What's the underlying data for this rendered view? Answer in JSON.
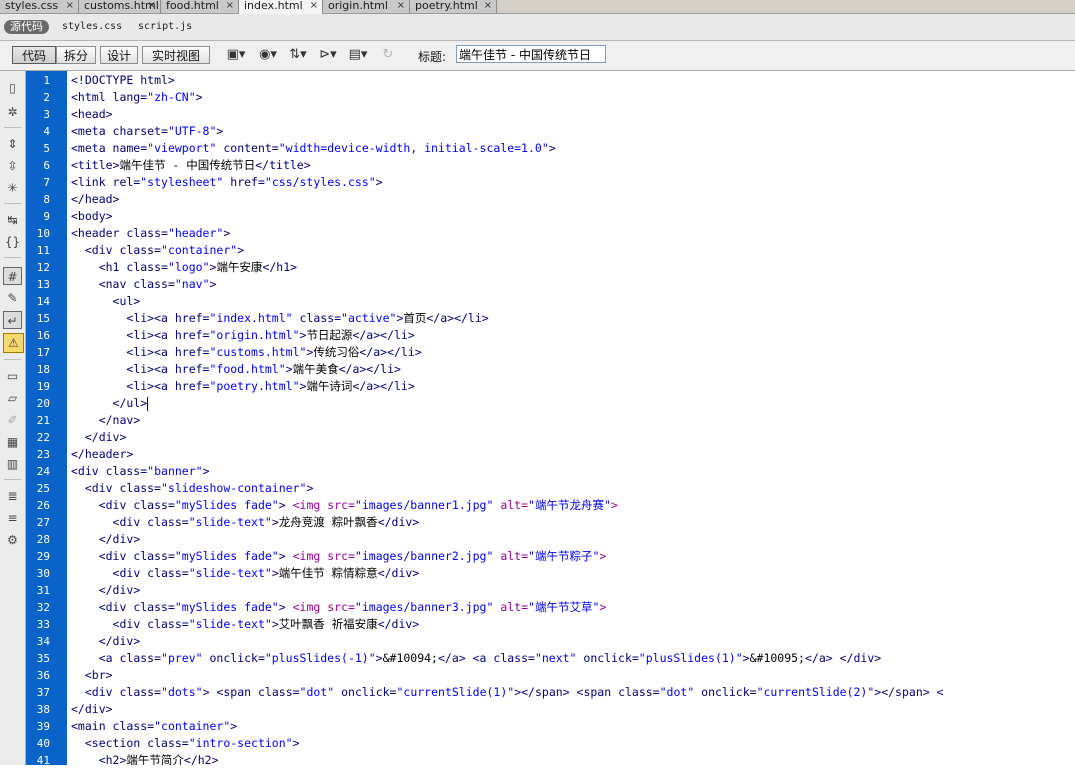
{
  "tabs": [
    {
      "label": "styles.css",
      "active": false
    },
    {
      "label": "customs.html",
      "active": false
    },
    {
      "label": "food.html",
      "active": false
    },
    {
      "label": "index.html",
      "active": true
    },
    {
      "label": "origin.html",
      "active": false
    },
    {
      "label": "poetry.html",
      "active": false
    }
  ],
  "tab_close_glyph": "×",
  "related": {
    "source_label": "源代码",
    "files": [
      "styles.css",
      "script.js"
    ]
  },
  "toolbar": {
    "view_buttons": [
      "代码",
      "拆分",
      "设计",
      "实时视图"
    ],
    "active_view": "代码",
    "icons": [
      "multiscreen-icon",
      "preview-browser-icon",
      "file-management-icon",
      "debug-icon",
      "visual-aids-icon",
      "refresh-icon"
    ],
    "title_label": "标题:",
    "title_value": "端午佳节 - 中国传统节日"
  },
  "left_toolbar_icons": [
    "open-documents-icon",
    "show-code-navigator-icon",
    "collapse-full-tag-icon",
    "collapse-selection-icon",
    "expand-all-icon",
    "select-parent-tag-icon",
    "balance-braces-icon",
    "line-numbers-icon",
    "highlight-invalid-code-icon",
    "word-wrap-icon",
    "syntax-error-alerts-icon",
    "apply-comment-icon",
    "remove-comment-icon",
    "wrap-tag-icon",
    "recent-snippets-icon",
    "move-css-icon",
    "indent-code-icon",
    "outdent-code-icon",
    "format-source-code-icon"
  ],
  "editor": {
    "cursor_line": 20,
    "lines": [
      "<!DOCTYPE html>",
      "<html lang=\"zh-CN\">",
      "<head>",
      "<meta charset=\"UTF-8\">",
      "<meta name=\"viewport\" content=\"width=device-width, initial-scale=1.0\">",
      "<title>端午佳节 - 中国传统节日</title>",
      "<link rel=\"stylesheet\" href=\"css/styles.css\">",
      "</head>",
      "<body>",
      "<header class=\"header\">",
      "  <div class=\"container\">",
      "    <h1 class=\"logo\">端午安康</h1>",
      "    <nav class=\"nav\">",
      "      <ul>",
      "        <li><a href=\"index.html\" class=\"active\">首页</a></li>",
      "        <li><a href=\"origin.html\">节日起源</a></li>",
      "        <li><a href=\"customs.html\">传统习俗</a></li>",
      "        <li><a href=\"food.html\">端午美食</a></li>",
      "        <li><a href=\"poetry.html\">端午诗词</a></li>",
      "      </ul>",
      "    </nav>",
      "  </div>",
      "</header>",
      "<div class=\"banner\">",
      "  <div class=\"slideshow-container\">",
      "    <div class=\"mySlides fade\"> <img src=\"images/banner1.jpg\" alt=\"端午节龙舟赛\">",
      "      <div class=\"slide-text\">龙舟竞渡 粽叶飘香</div>",
      "    </div>",
      "    <div class=\"mySlides fade\"> <img src=\"images/banner2.jpg\" alt=\"端午节粽子\">",
      "      <div class=\"slide-text\">端午佳节 粽情粽意</div>",
      "    </div>",
      "    <div class=\"mySlides fade\"> <img src=\"images/banner3.jpg\" alt=\"端午节艾草\">",
      "      <div class=\"slide-text\">艾叶飘香 祈福安康</div>",
      "    </div>",
      "    <a class=\"prev\" onclick=\"plusSlides(-1)\">&#10094;</a> <a class=\"next\" onclick=\"plusSlides(1)\">&#10095;</a> </div>",
      "  <br>",
      "  <div class=\"dots\"> <span class=\"dot\" onclick=\"currentSlide(1)\"></span> <span class=\"dot\" onclick=\"currentSlide(2)\"></span> <",
      "</div>",
      "<main class=\"container\">",
      "  <section class=\"intro-section\">",
      "    <h2>端午节简介</h2>"
    ]
  },
  "colors": {
    "gutter": "#0a63c9",
    "tag": "#000080",
    "attr_value": "#0000ff",
    "img_tag": "#990099",
    "text": "#000000"
  }
}
